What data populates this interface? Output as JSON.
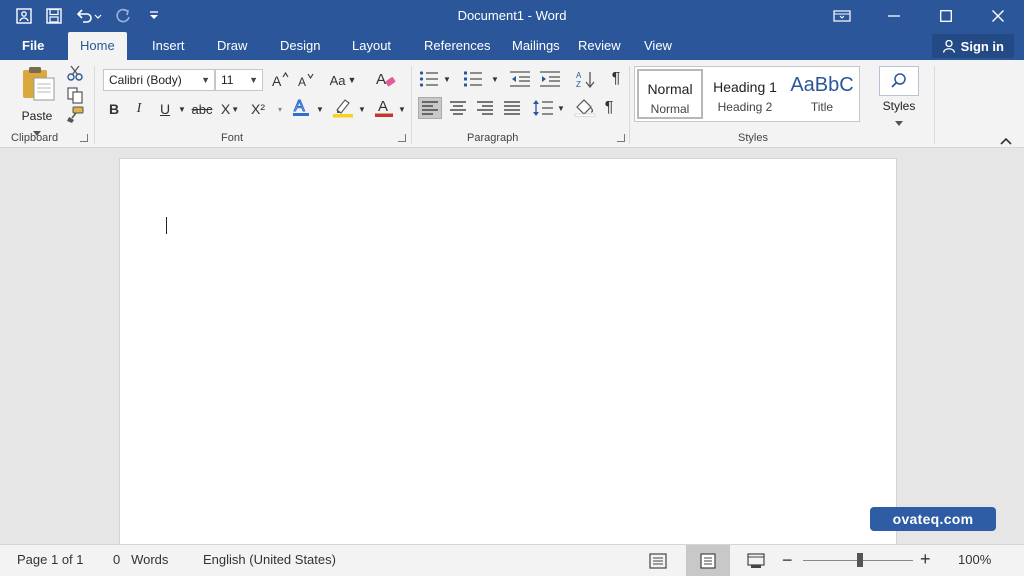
{
  "window": {
    "title": "Document1 - Word"
  },
  "quick_access": {
    "icons": [
      "word-doc-icon",
      "save-icon",
      "undo-icon",
      "redo-icon",
      "customize-qat-icon"
    ]
  },
  "tabs": {
    "file": "File",
    "items": [
      "Home",
      "Insert",
      "Draw",
      "Design",
      "Layout",
      "References",
      "Mailings",
      "Review",
      "View"
    ],
    "active": "Home"
  },
  "account": {
    "signin_label": "Sign in"
  },
  "ribbon": {
    "clipboard": {
      "label": "Clipboard",
      "paste_label": "Paste"
    },
    "font": {
      "label": "Font",
      "font_name": "Calibri (Body)",
      "font_size": "11",
      "case_label": "Aa",
      "bold": "B",
      "italic": "I",
      "underline": "U",
      "strike": "abc",
      "subscript": "X",
      "superscript": "X²",
      "highlight": "A"
    },
    "paragraph": {
      "label": "Paragraph"
    },
    "styles": {
      "label": "Styles",
      "items": [
        {
          "main": "Normal",
          "sub": "Normal"
        },
        {
          "main": "Heading 1",
          "sub": "Heading 2"
        },
        {
          "main": "AaBbC",
          "sub": "Title"
        }
      ],
      "button_label": "Styles"
    }
  },
  "statusbar": {
    "page": "Page 1 of 1",
    "word_count": "0",
    "words_label": "Words",
    "language": "English (United States)",
    "zoom": "100%"
  },
  "watermark": {
    "text": "ovateq.com"
  },
  "colors": {
    "brand": "#2b579a",
    "font_color": "#c0392b",
    "highlight": "#f5d21f",
    "text_effects": "#2f6fd0"
  }
}
